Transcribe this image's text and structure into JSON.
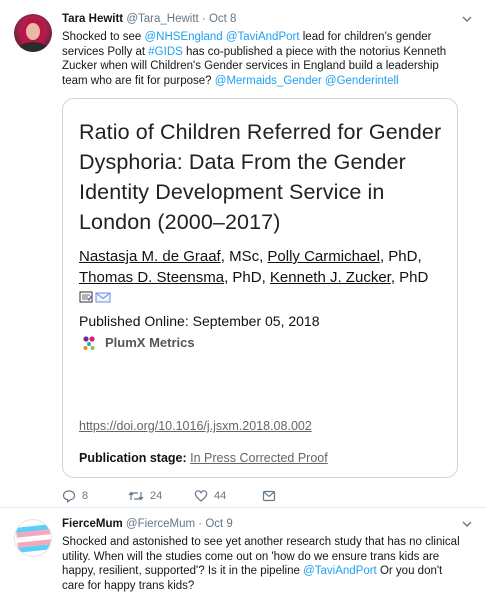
{
  "tweet1": {
    "display_name": "Tara Hewitt",
    "handle_time": "@Tara_Hewitt · Oct 8",
    "text": {
      "p1": "Shocked to see ",
      "m1": "@NHSEngland",
      "p2": " ",
      "m2": "@TaviAndPort",
      "p3": " lead for children's gender services Polly at ",
      "m3": "#GIDS",
      "p4": " has co-published a piece with the notorius Kenneth Zucker when will Children's Gender services in England build a leadership team who are fit for purpose? ",
      "m4": "@Mermaids_Gender",
      "p5": " ",
      "m5": "@Genderintell"
    },
    "card": {
      "title": "Ratio of Children Referred for Gender Dysphoria: Data From the Gender Identity Development Service in London (2000–2017)",
      "authors": {
        "a1": "Nastasja M. de Graaf",
        "s1": ", MSc, ",
        "a2": "Polly Carmichael",
        "s2": ", PhD, ",
        "a3": "Thomas D. Steensma",
        "s3": ", PhD, ",
        "a4": "Kenneth J. Zucker",
        "s4": ", PhD"
      },
      "published": "Published Online: September 05, 2018",
      "plumx": "PlumX Metrics",
      "doi": "https://doi.org/10.1016/j.jsxm.2018.08.002",
      "stage_label": "Publication stage:",
      "stage_value": "In Press Corrected Proof"
    },
    "actions": {
      "replies": "8",
      "retweets": "24",
      "likes": "44"
    }
  },
  "tweet2": {
    "display_name": "FierceMum",
    "handle_time": "@FierceMum · Oct 9",
    "text": {
      "p1": "Shocked and astonished to see yet another research study that has no clinical utility. When will the studies come out on 'how do we ensure trans kids are happy, resilient, supported'? Is it in the pipeline ",
      "m1": "@TaviAndPort",
      "p2": " Or you don't care for happy trans kids?"
    }
  },
  "colors": {
    "link": "#1da1f2",
    "meta": "#657786",
    "border": "#ccd6dd"
  },
  "icons": [
    "chevron-down-icon",
    "reply-icon",
    "retweet-icon",
    "heart-icon",
    "dm-icon",
    "plumx-icon",
    "mail-icon"
  ]
}
